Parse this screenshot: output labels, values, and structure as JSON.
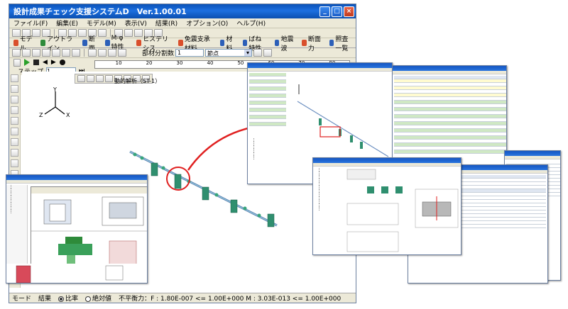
{
  "window": {
    "title": "設計成果チェック支援システムD　Ver.1.00.01",
    "minimize_label": "_",
    "maximize_label": "□",
    "close_label": "×"
  },
  "menu": [
    "ファイル(F)",
    "編集(E)",
    "モデル(M)",
    "表示(V)",
    "結果(R)",
    "オプション(O)",
    "ヘルプ(H)"
  ],
  "tabs": [
    "モデル",
    "アウトライン",
    "断面",
    "M-φ特性",
    "ヒステリシス",
    "免震支承材料",
    "材料",
    "ばね特性",
    "地震波",
    "断面力",
    "照査一覧"
  ],
  "toolbar2": {
    "member_division_label": "部材分割数",
    "member_division_value": "1",
    "mode_combo_value": "節点"
  },
  "ruler": {
    "ticks": [
      "10",
      "20",
      "30",
      "40",
      "50",
      "60",
      "70",
      "80"
    ]
  },
  "step_row": {
    "label": "ステップ",
    "value": "1",
    "caption": "動的解析（ST-1）"
  },
  "axes": {
    "y": "Y",
    "z": "Z",
    "x": "X"
  },
  "status": {
    "mode_label": "モード",
    "mode_value": "結果",
    "radio1": "比率",
    "radio2": "絶対値",
    "balance_text": "不平衡力：F : 1.80E-007 <= 1.00E+000 M : 3.03E-013 <= 1.00E+000"
  },
  "colors": {
    "titlebar": "#1560d0",
    "pipe": "#2f8f6f",
    "arrow": "#e02020"
  }
}
